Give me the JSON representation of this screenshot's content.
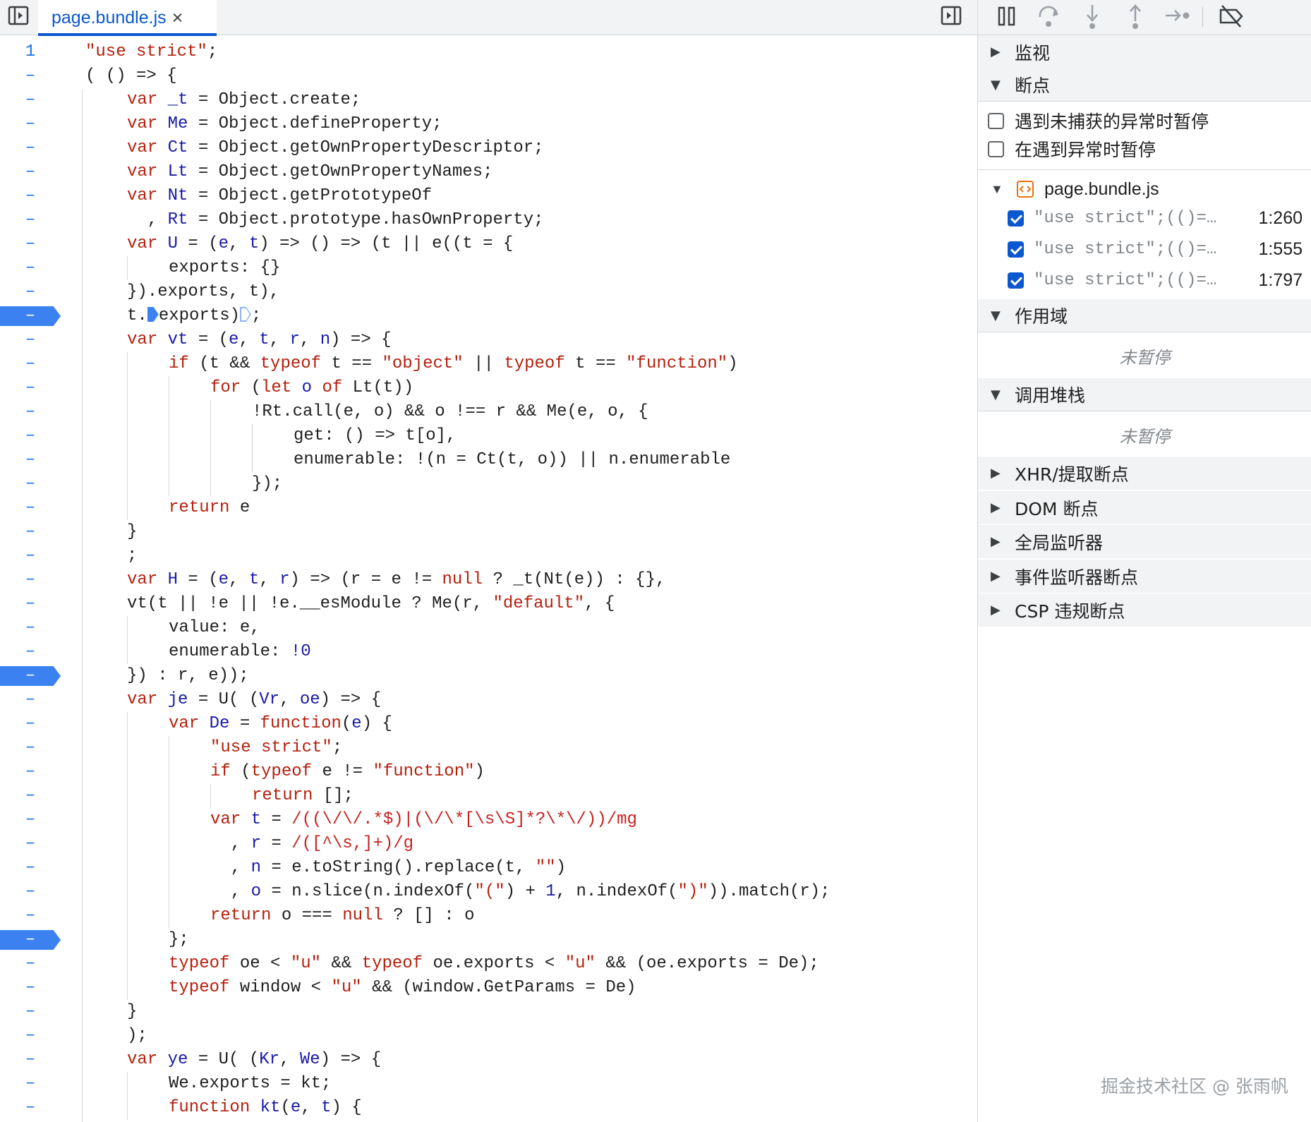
{
  "tab": {
    "filename": "page.bundle.js",
    "close": "×"
  },
  "toolbar": {
    "icons": [
      "sidebar-toggle-icon",
      "pause-icon",
      "step-over-icon",
      "step-into-icon",
      "step-out-icon",
      "step-icon",
      "deactivate-breakpoints-icon"
    ]
  },
  "code": {
    "lines": [
      {
        "num": "1",
        "bp": false,
        "indent": 0,
        "html": "<span class='s'>\"use strict\"</span>;"
      },
      {
        "num": "–",
        "bp": false,
        "indent": 0,
        "html": "( () =&gt; {"
      },
      {
        "num": "–",
        "bp": false,
        "indent": 1,
        "html": "<span class='k'>var</span> <span class='v'>_t</span> = Object.create;"
      },
      {
        "num": "–",
        "bp": false,
        "indent": 1,
        "html": "<span class='k'>var</span> <span class='v'>Me</span> = Object.defineProperty;"
      },
      {
        "num": "–",
        "bp": false,
        "indent": 1,
        "html": "<span class='k'>var</span> <span class='v'>Ct</span> = Object.getOwnPropertyDescriptor;"
      },
      {
        "num": "–",
        "bp": false,
        "indent": 1,
        "html": "<span class='k'>var</span> <span class='v'>Lt</span> = Object.getOwnPropertyNames;"
      },
      {
        "num": "–",
        "bp": false,
        "indent": 1,
        "html": "<span class='k'>var</span> <span class='v'>Nt</span> = Object.getPrototypeOf"
      },
      {
        "num": "–",
        "bp": false,
        "indent": 1,
        "html": "  , <span class='v'>Rt</span> = Object.prototype.hasOwnProperty;"
      },
      {
        "num": "–",
        "bp": false,
        "indent": 1,
        "html": "<span class='k'>var</span> <span class='v'>U</span> = (<span class='v'>e</span>, <span class='v'>t</span>) =&gt; () =&gt; (t || e((t = {"
      },
      {
        "num": "–",
        "bp": false,
        "indent": 2,
        "html": "exports: {}"
      },
      {
        "num": "–",
        "bp": false,
        "indent": 1,
        "html": "}).exports, t),"
      },
      {
        "num": "–",
        "bp": true,
        "indent": 1,
        "html": "t.<span class='stop-marker solid'></span>exports)<span class='stop-marker outline'></span>;"
      },
      {
        "num": "–",
        "bp": false,
        "indent": 1,
        "html": "<span class='k'>var</span> <span class='v'>vt</span> = (<span class='v'>e</span>, <span class='v'>t</span>, <span class='v'>r</span>, <span class='v'>n</span>) =&gt; {"
      },
      {
        "num": "–",
        "bp": false,
        "indent": 2,
        "html": "<span class='k'>if</span> (t &amp;&amp; <span class='k'>typeof</span> t == <span class='s'>\"object\"</span> || <span class='k'>typeof</span> t == <span class='s'>\"function\"</span>)"
      },
      {
        "num": "–",
        "bp": false,
        "indent": 3,
        "html": "<span class='k'>for</span> (<span class='k'>let</span> <span class='v'>o</span> <span class='k'>of</span> Lt(t))"
      },
      {
        "num": "–",
        "bp": false,
        "indent": 4,
        "html": "!Rt.call(e, o) &amp;&amp; o !== r &amp;&amp; Me(e, o, {"
      },
      {
        "num": "–",
        "bp": false,
        "indent": 5,
        "html": "get: () =&gt; t[o],"
      },
      {
        "num": "–",
        "bp": false,
        "indent": 5,
        "html": "enumerable: !(n = Ct(t, o)) || n.enumerable"
      },
      {
        "num": "–",
        "bp": false,
        "indent": 4,
        "html": "});"
      },
      {
        "num": "–",
        "bp": false,
        "indent": 2,
        "html": "<span class='k'>return</span> e"
      },
      {
        "num": "–",
        "bp": false,
        "indent": 1,
        "html": "}"
      },
      {
        "num": "–",
        "bp": false,
        "indent": 1,
        "html": ";"
      },
      {
        "num": "–",
        "bp": false,
        "indent": 1,
        "html": "<span class='k'>var</span> <span class='v'>H</span> = (<span class='v'>e</span>, <span class='v'>t</span>, <span class='v'>r</span>) =&gt; (r = e != <span class='k'>null</span> ? _t(Nt(e)) : {},"
      },
      {
        "num": "–",
        "bp": false,
        "indent": 1,
        "html": "vt(t || !e || !e.__esModule ? Me(r, <span class='s'>\"default\"</span>, {"
      },
      {
        "num": "–",
        "bp": false,
        "indent": 2,
        "html": "value: e,"
      },
      {
        "num": "–",
        "bp": false,
        "indent": 2,
        "html": "enumerable: <span class='n'>!0</span>"
      },
      {
        "num": "–",
        "bp": true,
        "indent": 1,
        "html": "}) : r, e));"
      },
      {
        "num": "–",
        "bp": false,
        "indent": 1,
        "html": "<span class='k'>var</span> <span class='v'>je</span> = U( (<span class='v'>Vr</span>, <span class='v'>oe</span>) =&gt; {"
      },
      {
        "num": "–",
        "bp": false,
        "indent": 2,
        "html": "<span class='k'>var</span> <span class='v'>De</span> = <span class='k'>function</span>(<span class='v'>e</span>) {"
      },
      {
        "num": "–",
        "bp": false,
        "indent": 3,
        "html": "<span class='s'>\"use strict\"</span>;"
      },
      {
        "num": "–",
        "bp": false,
        "indent": 3,
        "html": "<span class='k'>if</span> (<span class='k'>typeof</span> e != <span class='s'>\"function\"</span>)"
      },
      {
        "num": "–",
        "bp": false,
        "indent": 4,
        "html": "<span class='k'>return</span> [];"
      },
      {
        "num": "–",
        "bp": false,
        "indent": 3,
        "html": "<span class='k'>var</span> <span class='v'>t</span> = <span class='r'>/((\\/\\/.*$)|(\\/\\*[\\s\\S]*?\\*\\/))/mg</span>"
      },
      {
        "num": "–",
        "bp": false,
        "indent": 3,
        "html": "  , <span class='v'>r</span> = <span class='r'>/([^\\s,]+)/g</span>"
      },
      {
        "num": "–",
        "bp": false,
        "indent": 3,
        "html": "  , <span class='v'>n</span> = e.toString().replace(t, <span class='s'>\"\"</span>)"
      },
      {
        "num": "–",
        "bp": false,
        "indent": 3,
        "html": "  , <span class='v'>o</span> = n.slice(n.indexOf(<span class='s'>\"(\"</span>) + <span class='n'>1</span>, n.indexOf(<span class='s'>\")\"</span>)).match(r);"
      },
      {
        "num": "–",
        "bp": false,
        "indent": 3,
        "html": "<span class='k'>return</span> o === <span class='k'>null</span> ? [] : o"
      },
      {
        "num": "–",
        "bp": true,
        "indent": 2,
        "html": "};"
      },
      {
        "num": "–",
        "bp": false,
        "indent": 2,
        "html": "<span class='k'>typeof</span> oe &lt; <span class='s'>\"u\"</span> &amp;&amp; <span class='k'>typeof</span> oe.exports &lt; <span class='s'>\"u\"</span> &amp;&amp; (oe.exports = De);"
      },
      {
        "num": "–",
        "bp": false,
        "indent": 2,
        "html": "<span class='k'>typeof</span> window &lt; <span class='s'>\"u\"</span> &amp;&amp; (window.GetParams = De)"
      },
      {
        "num": "–",
        "bp": false,
        "indent": 1,
        "html": "}"
      },
      {
        "num": "–",
        "bp": false,
        "indent": 1,
        "html": ");"
      },
      {
        "num": "–",
        "bp": false,
        "indent": 1,
        "html": "<span class='k'>var</span> <span class='v'>ye</span> = U( (<span class='v'>Kr</span>, <span class='v'>We</span>) =&gt; {"
      },
      {
        "num": "–",
        "bp": false,
        "indent": 2,
        "html": "We.exports = kt;"
      },
      {
        "num": "–",
        "bp": false,
        "indent": 2,
        "html": "<span class='k'>function</span> <span class='v'>kt</span>(<span class='v'>e</span>, <span class='v'>t</span>) {"
      }
    ]
  },
  "panel": {
    "watch": "监视",
    "breakpoints": "断点",
    "pause_uncaught": "遇到未捕获的异常时暂停",
    "pause_caught": "在遇到异常时暂停",
    "bp_file": "page.bundle.js",
    "bp_entries": [
      {
        "snippet": "\"use strict\";(()=…",
        "loc": "1:260",
        "checked": true
      },
      {
        "snippet": "\"use strict\";(()=…",
        "loc": "1:555",
        "checked": true
      },
      {
        "snippet": "\"use strict\";(()=…",
        "loc": "1:797",
        "checked": true
      }
    ],
    "scope": "作用域",
    "scope_status": "未暂停",
    "callstack": "调用堆栈",
    "callstack_status": "未暂停",
    "xhr": "XHR/提取断点",
    "dom": "DOM 断点",
    "global": "全局监听器",
    "event": "事件监听器断点",
    "csp": "CSP 违规断点"
  },
  "watermark": "掘金技术社区 @ 张雨帆",
  "colors": {
    "accent": "#0b57d0",
    "breakpoint": "#3b82f0",
    "keyword": "#b5200d",
    "identifier": "#1a1aa6"
  }
}
